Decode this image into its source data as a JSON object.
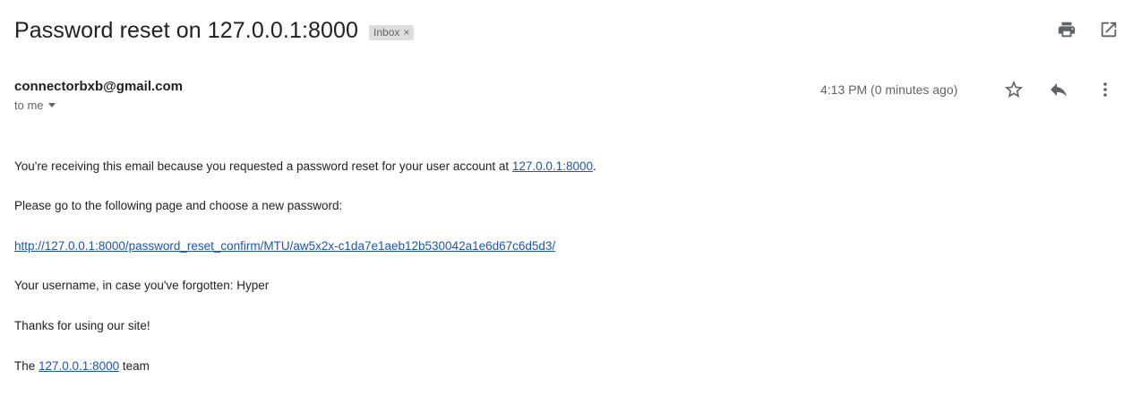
{
  "email": {
    "subject": "Password reset on 127.0.0.1:8000",
    "label": "Inbox",
    "label_close": "×",
    "sender": "connectorbxb@gmail.com",
    "to_line": "to me",
    "timestamp": "4:13 PM (0 minutes ago)"
  },
  "icons": {
    "print": "print-icon",
    "open_new_window": "open-in-new-window-icon",
    "star": "star-icon",
    "reply": "reply-icon",
    "more": "more-vert-icon"
  },
  "body": {
    "line1_prefix": "You're receiving this email because you requested a password reset for your user account at ",
    "line1_link": "127.0.0.1:8000",
    "line1_suffix": ".",
    "line2": "Please go to the following page and choose a new password:",
    "reset_link": "http://127.0.0.1:8000/password_reset_confirm/MTU/aw5x2x-c1da7e1aeb12b530042a1e6d67c6d5d3/",
    "line4": "Your username, in case you've forgotten: Hyper",
    "line5": "Thanks for using our site!",
    "line6_prefix": "The ",
    "line6_link": "127.0.0.1:8000",
    "line6_suffix": " team"
  },
  "colors": {
    "link": "#1a55b8",
    "label_bg": "#dddddd",
    "icon": "#5f6368"
  }
}
